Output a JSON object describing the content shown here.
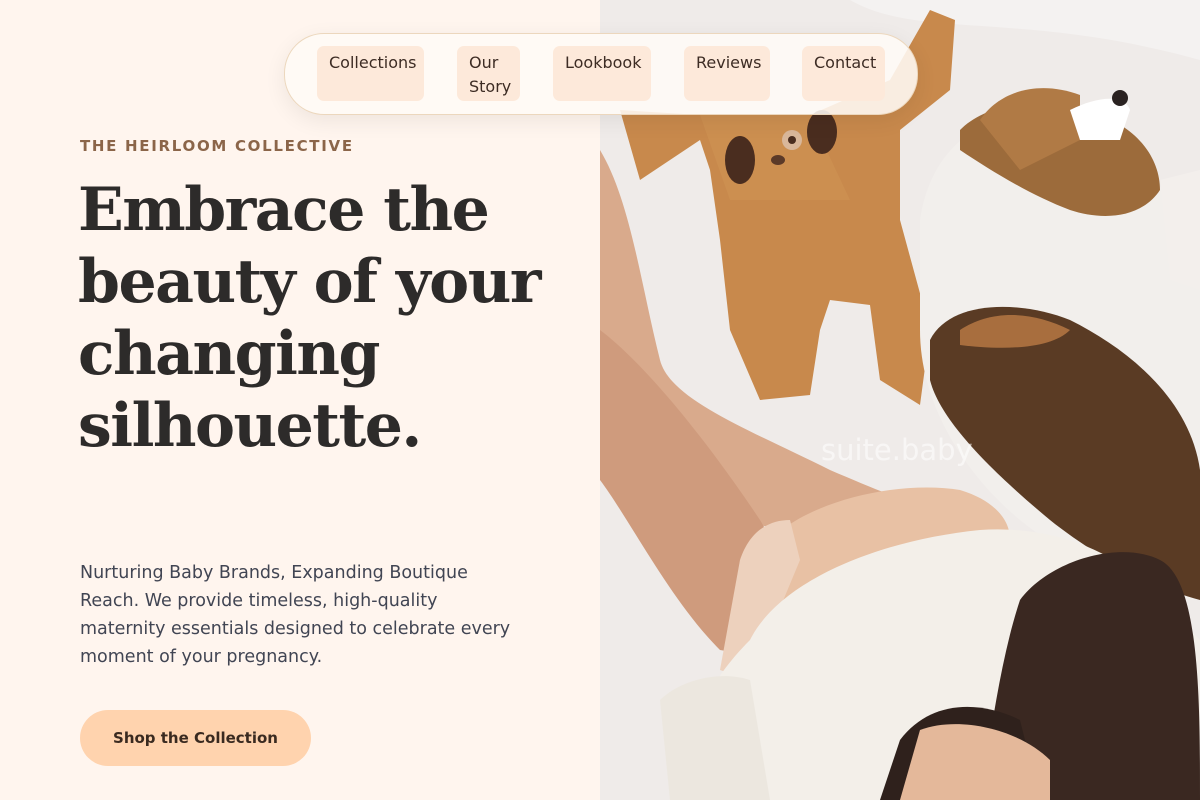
{
  "nav": {
    "items": [
      {
        "label": "Collections"
      },
      {
        "label": "Our Story"
      },
      {
        "label": "Lookbook"
      },
      {
        "label": "Reviews"
      },
      {
        "label": "Contact"
      }
    ]
  },
  "hero": {
    "eyebrow": "THE HEIRLOOM COLLECTIVE",
    "headline": "Embrace the beauty of your changing silhouette.",
    "subtext": "Nurturing Baby Brands, Expanding Boutique Reach. We provide timeless, high-quality maternity essentials designed to celebrate every moment of your pregnancy.",
    "cta_label": "Shop the Collection"
  },
  "photo": {
    "watermark": "suite.baby",
    "description_icon": "photo-pregnant-woman-with-dog-and-onesie"
  },
  "colors": {
    "background": "#fff5ee",
    "accent": "#ffd3ae",
    "nav_chip": "#fde9da",
    "eyebrow": "#8b6549",
    "headline": "#2d2b2a"
  }
}
